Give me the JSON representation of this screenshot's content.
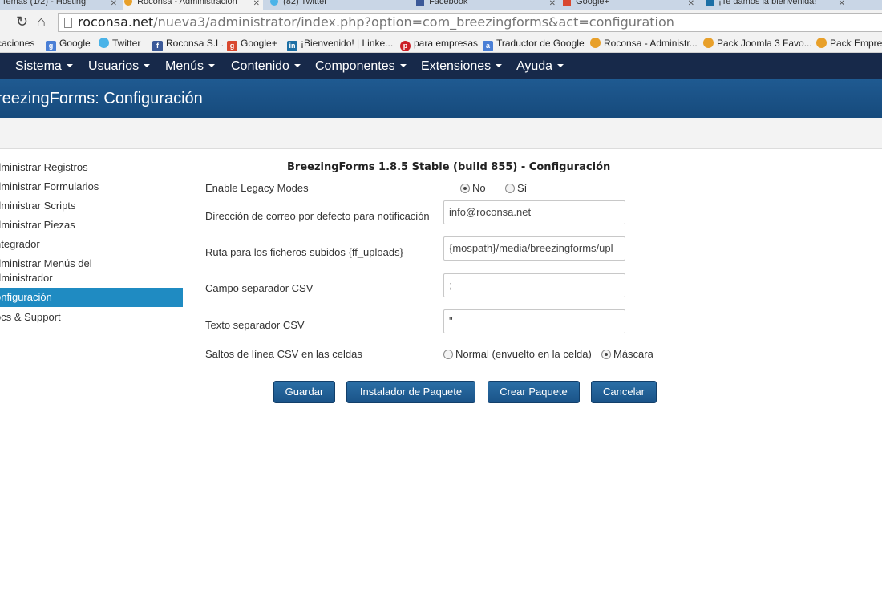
{
  "browser": {
    "tabs": [
      {
        "label": "Temas (1/2) - Hosting",
        "active": false
      },
      {
        "label": "Roconsa - Administración",
        "active": true
      },
      {
        "label": "(82) Twitter",
        "active": false
      },
      {
        "label": "Facebook",
        "active": false
      },
      {
        "label": "Google+",
        "active": false
      },
      {
        "label": "¡Te damos la bienvenida!",
        "active": false
      }
    ],
    "url_host": "roconsa.net",
    "url_path": "/nueva3/administrator/index.php?option=com_breezingforms&act=configuration",
    "bookmarks": [
      {
        "label": "caciones",
        "icon": "apps-icon",
        "color": "#f2f2f2"
      },
      {
        "label": "Google",
        "icon": "google-icon",
        "color": "#4a7fd6"
      },
      {
        "label": "Twitter",
        "icon": "twitter-icon",
        "color": "#4ab3e8"
      },
      {
        "label": "Roconsa S.L.",
        "icon": "facebook-icon",
        "color": "#3b5998"
      },
      {
        "label": "Google+",
        "icon": "google-plus-icon",
        "color": "#d9482f"
      },
      {
        "label": "¡Bienvenido! | Linke...",
        "icon": "linkedin-icon",
        "color": "#1c6fa5"
      },
      {
        "label": "para empresas",
        "icon": "pinterest-icon",
        "color": "#cb2027"
      },
      {
        "label": "Traductor de Google",
        "icon": "translate-icon",
        "color": "#4a7fd6"
      },
      {
        "label": "Roconsa - Administr...",
        "icon": "joomla-icon",
        "color": "#e8a02a"
      },
      {
        "label": "Pack Joomla 3 Favo...",
        "icon": "joomla-icon",
        "color": "#e8a02a"
      },
      {
        "label": "Pack Empres",
        "icon": "joomla-icon",
        "color": "#e8a02a"
      }
    ]
  },
  "navbar": {
    "items": [
      "Sistema",
      "Usuarios",
      "Menús",
      "Contenido",
      "Componentes",
      "Extensiones",
      "Ayuda"
    ]
  },
  "header": {
    "title": "reezingForms: Configuración"
  },
  "sidebar": {
    "items": [
      {
        "label": "dministrar Registros",
        "active": false
      },
      {
        "label": "dministrar Formularios",
        "active": false
      },
      {
        "label": "dministrar Scripts",
        "active": false
      },
      {
        "label": "dministrar Piezas",
        "active": false
      },
      {
        "label": "ntegrador",
        "active": false
      },
      {
        "label": "dministrar Menús del",
        "label2": "dministrador",
        "active": false
      },
      {
        "label": "onfiguración",
        "active": true
      },
      {
        "label": "ocs & Support",
        "active": false
      }
    ]
  },
  "form": {
    "title": "BreezingForms 1.8.5 Stable (build 855) - Configuración",
    "legacy": {
      "label": "Enable Legacy Modes",
      "options": [
        "No",
        "Sí"
      ],
      "selected": "No"
    },
    "email": {
      "label": "Dirección de correo por defecto para notificación",
      "value": "info@roconsa.net"
    },
    "uploads": {
      "label": "Ruta para los ficheros subidos {ff_uploads}",
      "value": "{mospath}/media/breezingforms/upl"
    },
    "csv_field": {
      "label": "Campo separador CSV",
      "value": ";"
    },
    "csv_text": {
      "label": "Texto separador CSV",
      "value": "\""
    },
    "csv_linebreaks": {
      "label": "Saltos de línea CSV en las celdas",
      "options": [
        "Normal (envuelto en la celda)",
        "Máscara"
      ],
      "selected": "Máscara"
    },
    "buttons": {
      "save": "Guardar",
      "installer": "Instalador de Paquete",
      "create": "Crear Paquete",
      "cancel": "Cancelar"
    }
  },
  "colors": {
    "navbar": "#17294a",
    "header": "#1f5a91",
    "sidebar_active": "#1f8bc2",
    "button": "#1a5388"
  }
}
